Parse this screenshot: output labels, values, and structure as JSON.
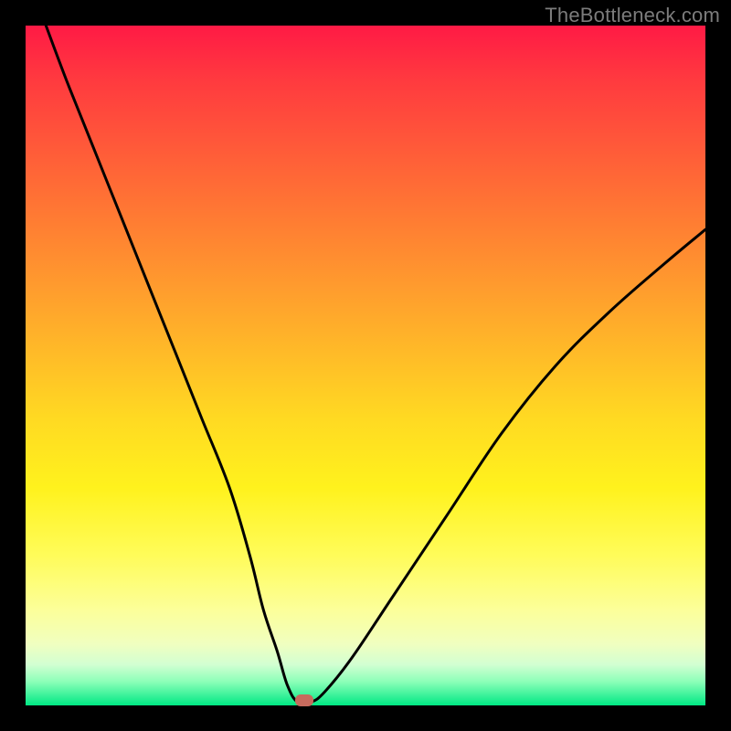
{
  "watermark": "TheBottleneck.com",
  "chart_data": {
    "type": "line",
    "title": "",
    "xlabel": "",
    "ylabel": "",
    "xlim": [
      0,
      100
    ],
    "ylim": [
      0,
      100
    ],
    "series": [
      {
        "name": "bottleneck-curve",
        "x": [
          3,
          6,
          10,
          14,
          18,
          22,
          26,
          30,
          33,
          35,
          37,
          38.5,
          40,
          42,
          44,
          48,
          54,
          62,
          70,
          78,
          86,
          94,
          100
        ],
        "y": [
          100,
          92,
          82,
          72,
          62,
          52,
          42,
          32,
          22,
          14,
          8,
          3,
          0.5,
          0.5,
          2,
          7,
          16,
          28,
          40,
          50,
          58,
          65,
          70
        ]
      }
    ],
    "marker": {
      "x": 41,
      "y": 0.5
    },
    "background_gradient": {
      "top": "#ff1a45",
      "mid": "#ffda22",
      "bottom": "#00e884"
    }
  }
}
